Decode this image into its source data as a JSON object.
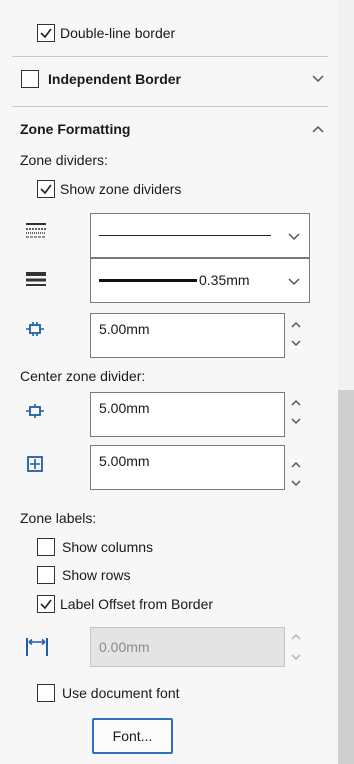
{
  "top": {
    "double_line_border": {
      "label": "Double-line border",
      "checked": true
    }
  },
  "independent_border": {
    "label": "Independent Border",
    "checked": false,
    "icon": "chevron-down-icon"
  },
  "zone_formatting": {
    "title": "Zone Formatting",
    "icon": "chevron-up-icon",
    "zone_dividers_label": "Zone dividers:",
    "show_zone_dividers": {
      "label": "Show zone dividers",
      "checked": true
    },
    "line_style_value": "",
    "line_weight_value": "0.35mm",
    "divider_spacing_value": "5.00mm",
    "center_zone_divider_label": "Center zone divider:",
    "center_horizontal_value": "5.00mm",
    "center_vertical_value": "5.00mm",
    "zone_labels_label": "Zone labels:",
    "show_columns": {
      "label": "Show columns",
      "checked": false
    },
    "show_rows": {
      "label": "Show rows",
      "checked": false
    },
    "label_offset": {
      "label": "Label Offset from Border",
      "checked": true
    },
    "offset_value": "0.00mm",
    "use_document_font": {
      "label": "Use document font",
      "checked": false
    },
    "font_button": "Font..."
  },
  "colors": {
    "accent": "#2f6fc1",
    "icon_blue": "#1f5fa8",
    "disabled_bg": "#e4e4e4"
  }
}
